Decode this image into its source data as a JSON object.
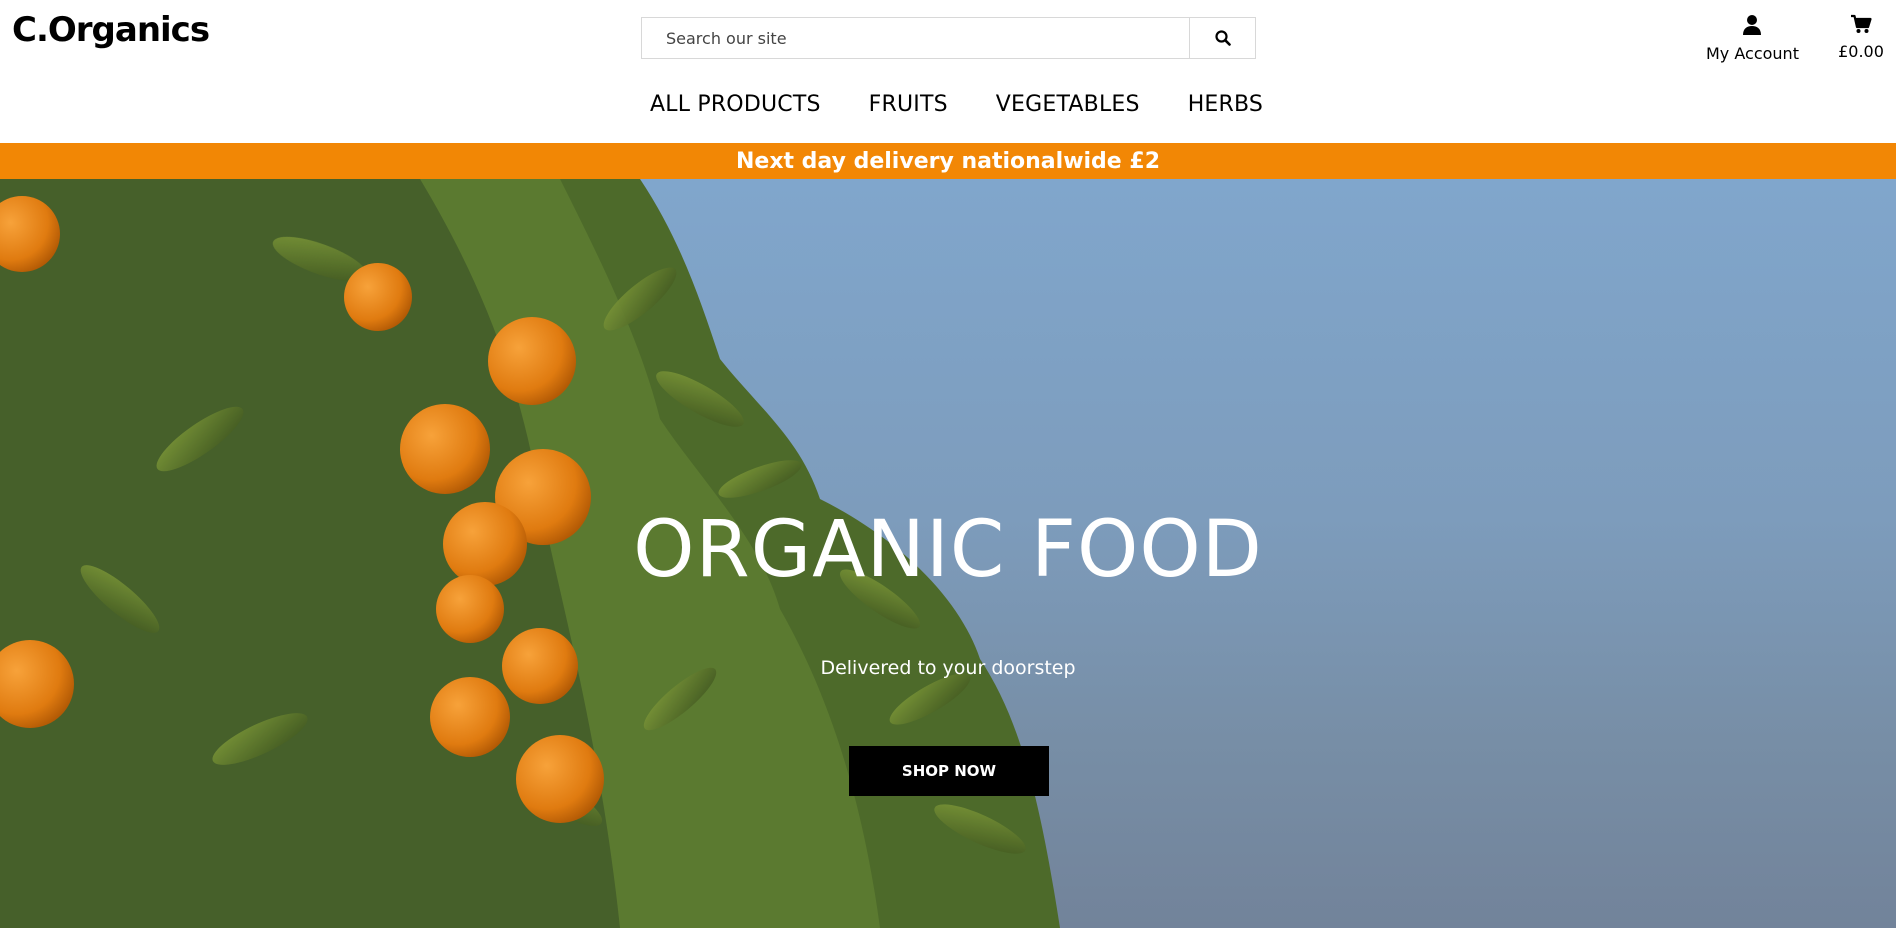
{
  "header": {
    "logo": "C.Organics",
    "search": {
      "placeholder": "Search our site",
      "value": ""
    },
    "account_label": "My Account",
    "cart_total": "£0.00"
  },
  "nav": {
    "items": [
      {
        "label": "ALL PRODUCTS"
      },
      {
        "label": "FRUITS"
      },
      {
        "label": "VEGETABLES"
      },
      {
        "label": "HERBS"
      }
    ]
  },
  "banner": {
    "text": "Next day delivery nationalwide £2"
  },
  "hero": {
    "title": "ORGANIC FOOD",
    "subtitle": "Delivered to your doorstep",
    "cta_label": "SHOP NOW"
  },
  "colors": {
    "banner": "#f28705",
    "cta_background": "#000000",
    "sky": "#80a6cc"
  },
  "icons": [
    "search-icon",
    "user-icon",
    "cart-icon"
  ]
}
